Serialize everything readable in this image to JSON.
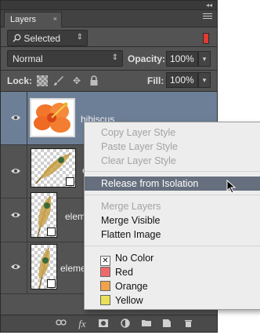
{
  "panel": {
    "tab_label": "Layers",
    "tab_close": "×",
    "collapse": "◂◂"
  },
  "filter": {
    "icon": "search-icon",
    "value": "Selected",
    "toggle_color": "#e23b2f"
  },
  "blend": {
    "mode": "Normal",
    "opacity_label": "Opacity:",
    "opacity_value": "100%"
  },
  "lock": {
    "label": "Lock:",
    "fill_label": "Fill:",
    "fill_value": "100%",
    "icons": [
      "lock-transparent-icon",
      "brush-icon",
      "move-icon",
      "lock-icon"
    ]
  },
  "layers": [
    {
      "name": "hibiscus",
      "selected": true
    },
    {
      "name": "e"
    },
    {
      "name": "elem"
    },
    {
      "name": "eleme"
    }
  ],
  "context_menu": {
    "copy_style": "Copy Layer Style",
    "paste_style": "Paste Layer Style",
    "clear_style": "Clear Layer Style",
    "release": "Release from Isolation",
    "merge_layers": "Merge Layers",
    "merge_visible": "Merge Visible",
    "flatten": "Flatten Image",
    "colors": [
      {
        "label": "No Color",
        "swatch": "none"
      },
      {
        "label": "Red",
        "swatch": "#ef6b6b"
      },
      {
        "label": "Orange",
        "swatch": "#f2a24a"
      },
      {
        "label": "Yellow",
        "swatch": "#e9df5a"
      }
    ]
  },
  "bottom_bar": {
    "fx_label": "fx"
  },
  "colors": {
    "panel_bg": "#535353",
    "selected_layer": "#6d7f96",
    "menu_highlight": "#666f7e"
  }
}
